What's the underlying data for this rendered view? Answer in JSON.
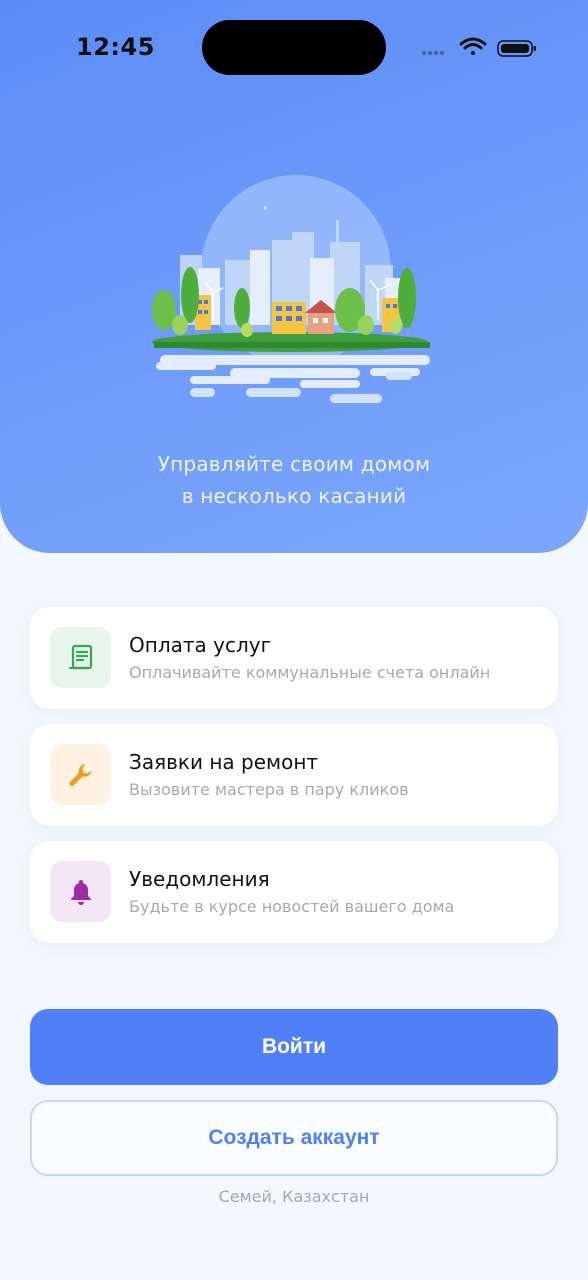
{
  "status_bar": {
    "time": "12:45",
    "icons": [
      "signal-dots-icon",
      "wifi-icon",
      "battery-icon"
    ]
  },
  "hero": {
    "tagline_line1": "Управляйте своим домом",
    "tagline_line2": "в несколько касаний",
    "illustration": "city-illustration",
    "colors": {
      "gradient_start": "#5b8cf8",
      "gradient_end": "#7ba6fb"
    }
  },
  "features": [
    {
      "title": "Оплата услуг",
      "subtitle": "Оплачивайте коммунальные счета онлайн",
      "icon": "receipt-icon",
      "icon_color": "#3aa655",
      "icon_bg": "#e8f5ea"
    },
    {
      "title": "Заявки на ремонт",
      "subtitle": "Вызовите мастера в пару кликов",
      "icon": "wrench-icon",
      "icon_color": "#f39a1e",
      "icon_bg": "#fff2e3"
    },
    {
      "title": "Уведомления",
      "subtitle": "Будьте в курсе новостей вашего дома",
      "icon": "bell-icon",
      "icon_color": "#9c2aa8",
      "icon_bg": "#f4e6f6"
    }
  ],
  "actions": {
    "login_label": "Войти",
    "create_account_label": "Создать аккаунт",
    "accent_color": "#4f80f7"
  },
  "footer": {
    "location": "Семей, Казахстан"
  }
}
